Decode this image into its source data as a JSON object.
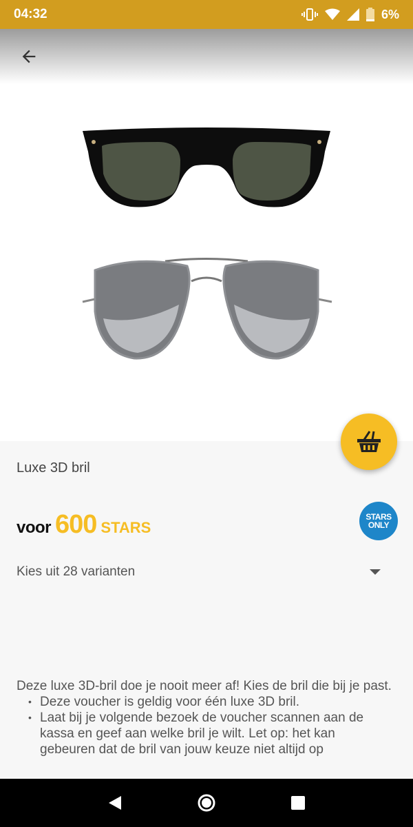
{
  "status_bar": {
    "time": "04:32",
    "battery_pct": "6%",
    "icons": [
      "vibrate-icon",
      "wifi-icon",
      "signal-icon",
      "battery-icon"
    ]
  },
  "header": {
    "back_icon": "arrow-left-icon"
  },
  "product": {
    "title": "Luxe 3D bril",
    "price_prefix": "voor",
    "price_amount": "600",
    "price_unit": "STARS",
    "badge_line1": "STARS",
    "badge_line2": "ONLY",
    "variant_label": "Kies uit 28 varianten",
    "description_intro": "Deze luxe 3D-bril doe je nooit meer af! Kies de bril die bij je past.",
    "bullets": [
      "Deze voucher is geldig voor één luxe 3D bril.",
      "Laat bij je volgende bezoek de voucher scannen aan de kassa en geef aan welke bril je wilt. Let op: het kan gebeuren dat de bril van jouw keuze niet altijd op"
    ]
  },
  "colors": {
    "status_bar": "#d29d1f",
    "accent": "#f6bd24",
    "badge": "#1e86c9"
  },
  "nav": {
    "icons": [
      "back-triangle-icon",
      "home-circle-icon",
      "recents-square-icon"
    ]
  }
}
